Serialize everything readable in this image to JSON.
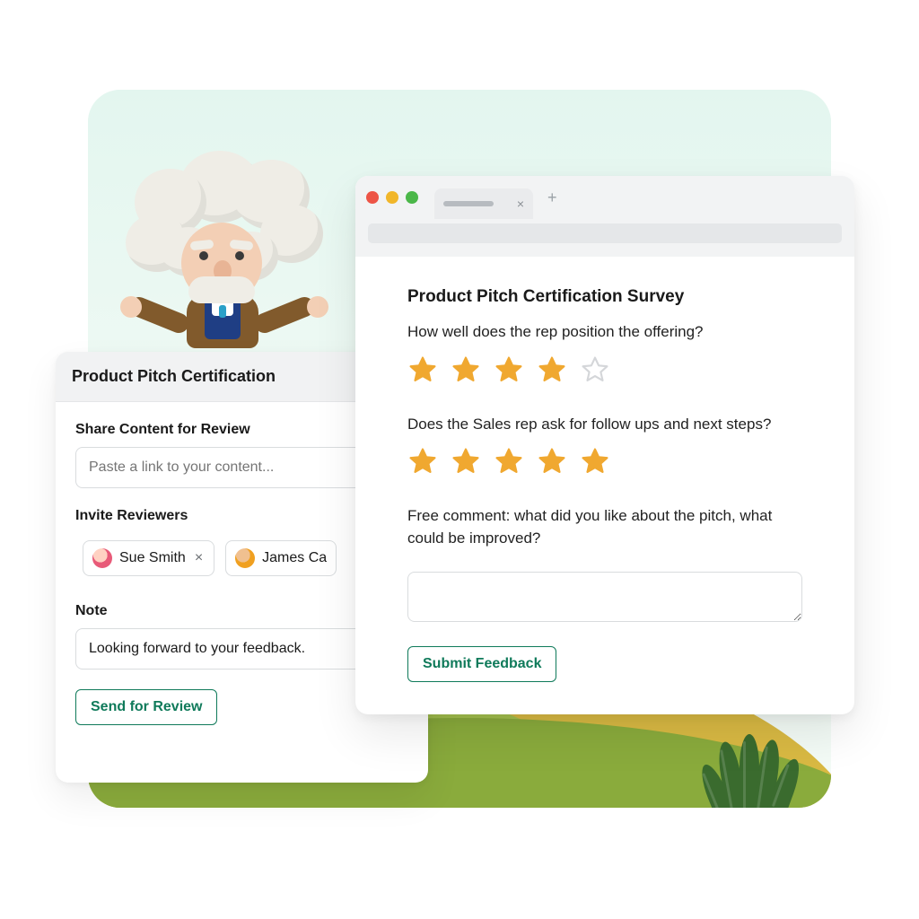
{
  "review_card": {
    "title": "Product Pitch Certification",
    "share_label": "Share Content for Review",
    "share_placeholder": "Paste a link to your content...",
    "invite_label": "Invite Reviewers",
    "reviewers": [
      {
        "name": "Sue Smith",
        "removable": true
      },
      {
        "name": "James Ca",
        "removable": false
      }
    ],
    "note_label": "Note",
    "note_value": "Looking forward to your feedback.",
    "send_button": "Send for Review"
  },
  "survey": {
    "title": "Product Pitch Certification Survey",
    "q1": "How well does the rep position the offering?",
    "q1_rating": 4,
    "q2": "Does the Sales rep ask for follow ups and next steps?",
    "q2_rating": 5,
    "q3": "Free comment:  what did you like about the pitch, what could be improved?",
    "submit_button": "Submit Feedback"
  },
  "browser": {
    "newtab": "+",
    "tab_close": "×"
  },
  "colors": {
    "accent": "#0f7a5a",
    "star_fill": "#f0a830",
    "star_empty": "#d4d6d9"
  }
}
